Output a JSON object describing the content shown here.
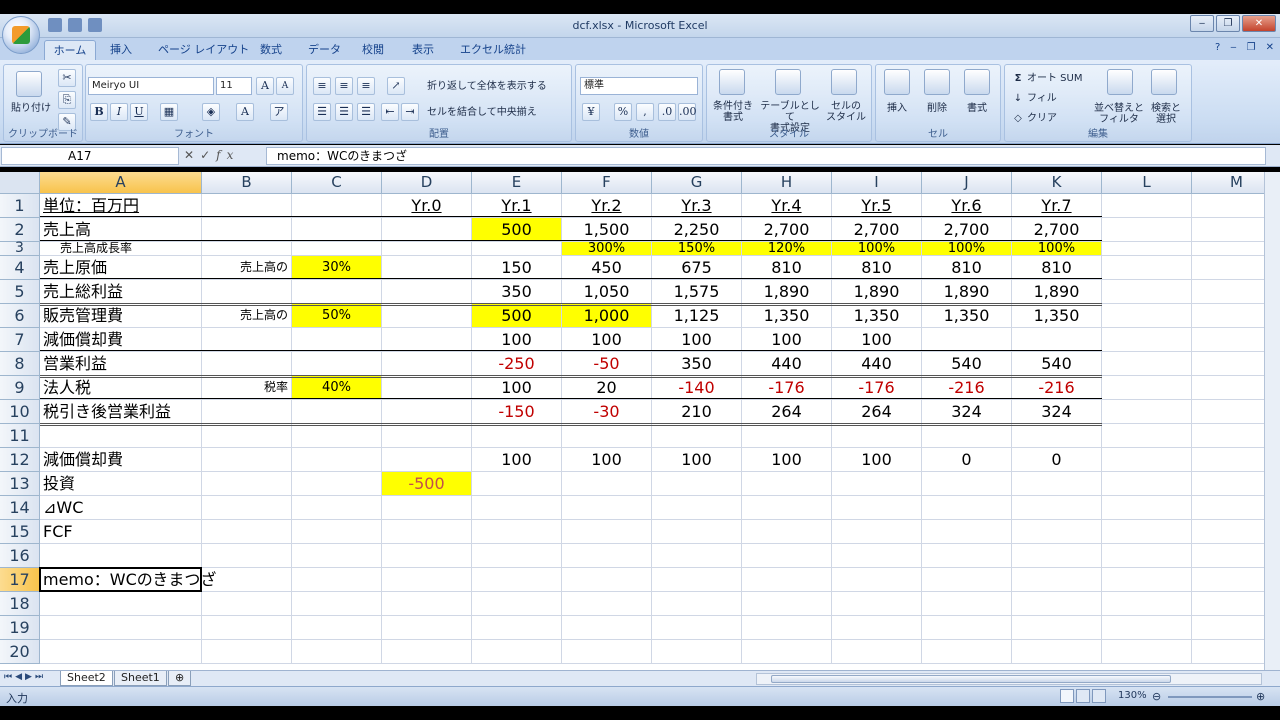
{
  "window": {
    "title": "dcf.xlsx - Microsoft Excel",
    "controls": {
      "minimize": "‒",
      "restore": "❐",
      "close": "✕"
    }
  },
  "ribbon": {
    "tabs": [
      "ホーム",
      "挿入",
      "ページ レイアウト",
      "数式",
      "データ",
      "校閲",
      "表示",
      "エクセル統計"
    ],
    "clipboard": {
      "paste": "貼り付け",
      "title": "クリップボード"
    },
    "font": {
      "name": "Meiryo UI",
      "size": "11",
      "grow": "A",
      "shrink": "A",
      "bold": "B",
      "italic": "I",
      "underline": "U",
      "title": "フォント"
    },
    "alignment": {
      "wrap": "折り返して全体を表示する",
      "merge": "セルを結合して中央揃え",
      "title": "配置"
    },
    "number": {
      "format": "標準",
      "percent": "%",
      "comma": ",",
      "title": "数値"
    },
    "styles": {
      "conditional": "条件付き\n書式",
      "table": "テーブルとして\n書式設定",
      "cellstyle": "セルの\nスタイル",
      "title": "スタイル"
    },
    "cells": {
      "insert": "挿入",
      "delete": "削除",
      "format": "書式",
      "title": "セル"
    },
    "editing": {
      "autosum": "オート SUM",
      "fill": "フィル",
      "clear": "クリア",
      "sort": "並べ替えと\nフィルタ",
      "find": "検索と\n選択",
      "title": "編集"
    }
  },
  "formula_bar": {
    "name_box": "A17",
    "fx": "fx",
    "formula": "memo：WCのきまつざ"
  },
  "columns": [
    "A",
    "B",
    "C",
    "D",
    "E",
    "F",
    "G",
    "H",
    "I",
    "J",
    "K",
    "L",
    "M"
  ],
  "selected_col": "A",
  "selected_row": 17,
  "rows": [
    {
      "n": 1,
      "A": "単位：百万円",
      "D": "Yr.0",
      "E": "Yr.1",
      "F": "Yr.2",
      "G": "Yr.3",
      "H": "Yr.4",
      "I": "Yr.5",
      "J": "Yr.6",
      "K": "Yr.7"
    },
    {
      "n": 2,
      "A": "売上高",
      "E": "500",
      "F": "1,500",
      "G": "2,250",
      "H": "2,700",
      "I": "2,700",
      "J": "2,700",
      "K": "2,700"
    },
    {
      "n": 3,
      "A": "売上高成長率",
      "F": "300%",
      "G": "150%",
      "H": "120%",
      "I": "100%",
      "J": "100%",
      "K": "100%"
    },
    {
      "n": 4,
      "A": "売上原価",
      "B": "売上高の",
      "C": "30%",
      "E": "150",
      "F": "450",
      "G": "675",
      "H": "810",
      "I": "810",
      "J": "810",
      "K": "810"
    },
    {
      "n": 5,
      "A": "売上総利益",
      "E": "350",
      "F": "1,050",
      "G": "1,575",
      "H": "1,890",
      "I": "1,890",
      "J": "1,890",
      "K": "1,890"
    },
    {
      "n": 6,
      "A": "販売管理費",
      "B": "売上高の",
      "C": "50%",
      "E": "500",
      "F": "1,000",
      "G": "1,125",
      "H": "1,350",
      "I": "1,350",
      "J": "1,350",
      "K": "1,350"
    },
    {
      "n": 7,
      "A": "減価償却費",
      "E": "100",
      "F": "100",
      "G": "100",
      "H": "100",
      "I": "100"
    },
    {
      "n": 8,
      "A": "営業利益",
      "E": "-250",
      "F": "-50",
      "G": "350",
      "H": "440",
      "I": "440",
      "J": "540",
      "K": "540"
    },
    {
      "n": 9,
      "A": "法人税",
      "B": "税率",
      "C": "40%",
      "E": "100",
      "F": "20",
      "G": "-140",
      "H": "-176",
      "I": "-176",
      "J": "-216",
      "K": "-216"
    },
    {
      "n": 10,
      "A": "税引き後営業利益",
      "E": "-150",
      "F": "-30",
      "G": "210",
      "H": "264",
      "I": "264",
      "J": "324",
      "K": "324"
    },
    {
      "n": 11
    },
    {
      "n": 12,
      "A": "減価償却費",
      "E": "100",
      "F": "100",
      "G": "100",
      "H": "100",
      "I": "100",
      "J": "0",
      "K": "0"
    },
    {
      "n": 13,
      "A": "投資",
      "D": "-500"
    },
    {
      "n": 14,
      "A": "⊿WC"
    },
    {
      "n": 15,
      "A": "FCF"
    },
    {
      "n": 16
    },
    {
      "n": 17,
      "A": "memo：WCのきまつざ"
    },
    {
      "n": 18
    },
    {
      "n": 19
    },
    {
      "n": 20
    }
  ],
  "colors": {
    "highlight": "#ffff00",
    "negative": "#c00000",
    "selection": "#f8c34c"
  },
  "sheet_tabs": [
    "Sheet2",
    "Sheet1"
  ],
  "active_sheet": "Sheet2",
  "status": {
    "mode": "入力",
    "zoom": "130%"
  }
}
